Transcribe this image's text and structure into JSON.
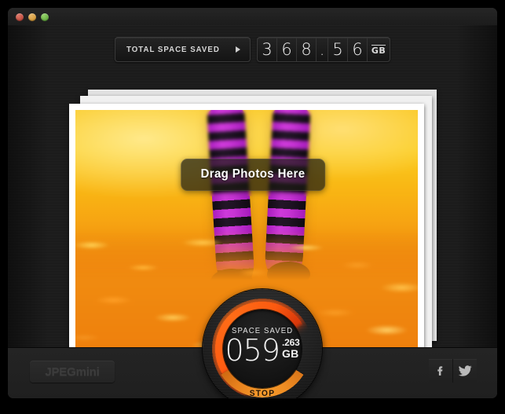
{
  "window": {
    "controls": [
      {
        "name": "close",
        "color": "#b03328"
      },
      {
        "name": "minimize",
        "color": "#c98a22"
      },
      {
        "name": "zoom",
        "color": "#4f9b2c"
      }
    ]
  },
  "counter": {
    "button_label": "TOTAL SPACE SAVED",
    "arrow_icon": "triangle-right-icon",
    "digits": [
      "3",
      "6",
      "8",
      ".",
      "5",
      "6"
    ],
    "unit": "GB",
    "value": "368.56"
  },
  "photo_area": {
    "drag_hint": "Drag Photos Here",
    "stack_count": 3,
    "photo_description": "legs in purple and black striped socks standing in orange autumn leaves"
  },
  "gauge": {
    "caption": "SPACE SAVED",
    "integer": "059",
    "fraction": ".263",
    "unit": "GB",
    "value": "059.263 GB",
    "stop_label": "STOP",
    "arc_color": "#ff5a12",
    "stop_color": "#ef8d23",
    "progress_percent": 60
  },
  "bottom_bar": {
    "brand": "JPEGmini",
    "social": [
      {
        "name": "facebook-icon",
        "glyph": "f"
      },
      {
        "name": "twitter-icon",
        "glyph": "bird"
      }
    ]
  }
}
